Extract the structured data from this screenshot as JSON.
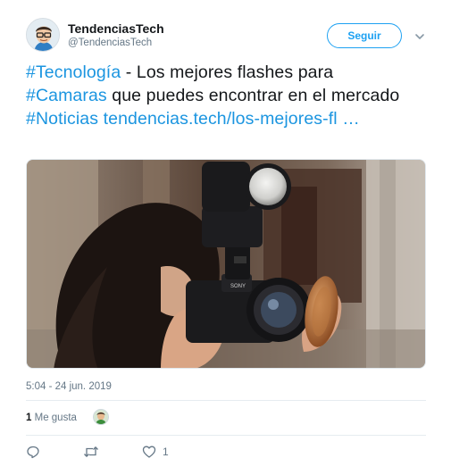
{
  "user": {
    "name": "TendenciasTech",
    "handle": "@TendenciasTech"
  },
  "follow_label": "Seguir",
  "tweet": {
    "hashtag_1": "#Tecnología",
    "text_1": " - Los mejores flashes para ",
    "hashtag_2": "#Camaras",
    "text_2": " que puedes encontrar en el mercado ",
    "hashtag_3": "#Noticias",
    "link": "tendencias.tech/los-mejores-fl",
    "ellipsis": "  …"
  },
  "timestamp": "5:04 - 24 jun. 2019",
  "likes": {
    "count": "1",
    "label": "Me gusta"
  },
  "actions": {
    "reply_count": "",
    "retweet_count": "",
    "like_count": "1"
  },
  "icons": [
    "chevron-down-icon",
    "reply-icon",
    "retweet-icon",
    "heart-icon"
  ],
  "colors": {
    "accent": "#1da1f2",
    "link": "#1b95e0",
    "muted": "#657786"
  }
}
